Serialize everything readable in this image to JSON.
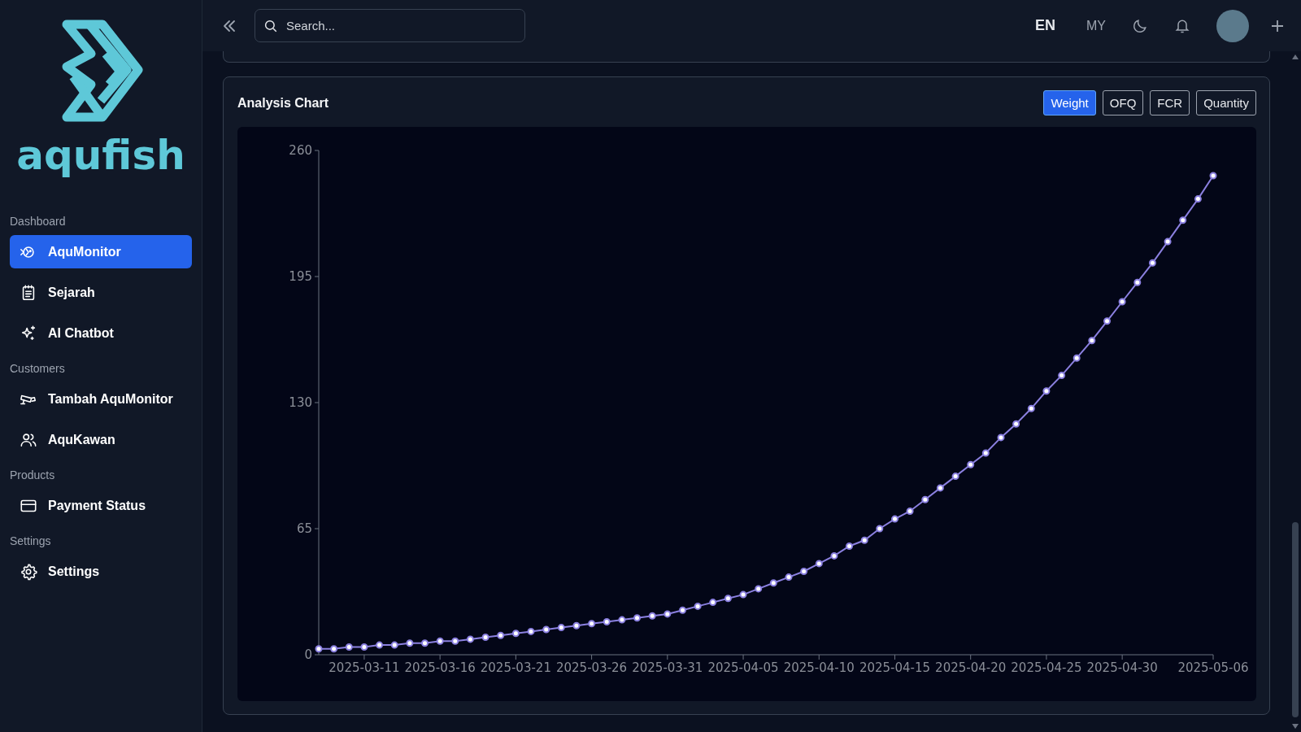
{
  "sidebar": {
    "brand": "aqufish",
    "sections": [
      {
        "label": "Dashboard",
        "items": [
          {
            "label": "AquMonitor",
            "selected": true
          },
          {
            "label": "Sejarah",
            "selected": false
          },
          {
            "label": "AI Chatbot",
            "selected": false
          }
        ]
      },
      {
        "label": "Customers",
        "items": [
          {
            "label": "Tambah AquMonitor",
            "selected": false
          },
          {
            "label": "AquKawan",
            "selected": false
          }
        ]
      },
      {
        "label": "Products",
        "items": [
          {
            "label": "Payment Status",
            "selected": false
          }
        ]
      },
      {
        "label": "Settings",
        "items": [
          {
            "label": "Settings",
            "selected": false
          }
        ]
      }
    ]
  },
  "header": {
    "search": {
      "placeholder": "Search..."
    },
    "languages": [
      {
        "label": "EN",
        "selected": true
      },
      {
        "label": "MY",
        "selected": false
      }
    ]
  },
  "analysis_chart": {
    "title": "Analysis Chart",
    "metrics": [
      {
        "label": "Weight",
        "selected": true
      },
      {
        "label": "OFQ",
        "selected": false
      },
      {
        "label": "FCR",
        "selected": false
      },
      {
        "label": "Quantity",
        "selected": false
      }
    ],
    "chart_data": {
      "type": "line",
      "categories": [
        null,
        null,
        null,
        "2025-03-11",
        null,
        null,
        null,
        null,
        "2025-03-16",
        null,
        null,
        null,
        null,
        "2025-03-21",
        null,
        null,
        null,
        null,
        "2025-03-26",
        null,
        null,
        null,
        null,
        "2025-03-31",
        null,
        null,
        null,
        null,
        "2025-04-05",
        null,
        null,
        null,
        null,
        "2025-04-10",
        null,
        null,
        null,
        null,
        "2025-04-15",
        null,
        null,
        null,
        null,
        "2025-04-20",
        null,
        null,
        null,
        null,
        "2025-04-25",
        null,
        null,
        null,
        null,
        "2025-04-30",
        null,
        null,
        null,
        null,
        null,
        "2025-05-06"
      ],
      "series": [
        {
          "color": "#8b80e0",
          "marker": true,
          "values": [
            3,
            3,
            4,
            4,
            5,
            5,
            6,
            6,
            7,
            7,
            8,
            9,
            10,
            11,
            12,
            13,
            14,
            15,
            16,
            17,
            18,
            19,
            20,
            21,
            23,
            25,
            27,
            29,
            31,
            34,
            37,
            40,
            43,
            47,
            51,
            56,
            59,
            65,
            70,
            74,
            80,
            86,
            92,
            98,
            104,
            112,
            119,
            127,
            136,
            144,
            153,
            162,
            172,
            182,
            192,
            202,
            213,
            224,
            235,
            247
          ]
        }
      ],
      "ylim": [
        0,
        260
      ],
      "yticks": [
        0,
        65,
        130,
        195,
        260
      ]
    }
  }
}
